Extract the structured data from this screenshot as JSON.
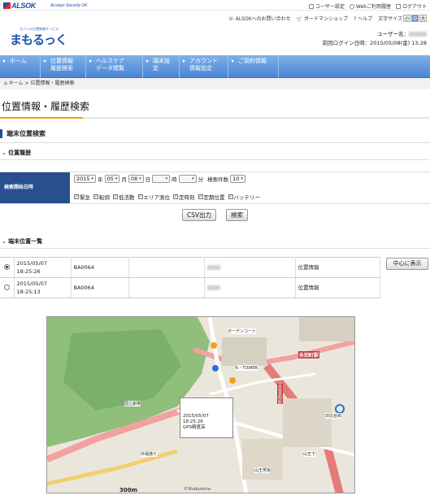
{
  "brand": {
    "name": "ALSOK",
    "tagline": "ALways Security OK",
    "logo_tagline": "モバイル位置情報サービス",
    "logo_text": "まもるっく"
  },
  "top_links": [
    "ユーザー設定",
    "Webご利用履歴",
    "ログアウト"
  ],
  "sub_links": [
    "ALSOKへのお問い合わせ",
    "ガードマンショップ",
    "ヘルプ"
  ],
  "font_size": {
    "label": "文字サイズ",
    "options": [
      "小",
      "中",
      "大"
    ],
    "selected": "中"
  },
  "user": {
    "label": "ユーザー名：",
    "last_login": "前回ログイン日時：2015/05/08(金) 13:28"
  },
  "nav": [
    {
      "line1": "ホーム",
      "line2": ""
    },
    {
      "line1": "位置情報",
      "line2": "履歴検索"
    },
    {
      "line1": "ヘルスケア",
      "line2": "データ閲覧"
    },
    {
      "line1": "端末設定",
      "line2": ""
    },
    {
      "line1": "アカウント",
      "line2": "情報設定"
    },
    {
      "line1": "ご契約情報",
      "line2": ""
    }
  ],
  "breadcrumb": {
    "home": "ホーム",
    "sep": ">",
    "current": "位置情報・履歴検索"
  },
  "page_title": "位置情報・履歴検索",
  "section_title": "端末位置検索",
  "history_subtitle": "位置履歴",
  "form": {
    "label": "検索開始日時",
    "year": "2015",
    "year_unit": "年",
    "month": "05",
    "month_unit": "月",
    "day": "08",
    "day_unit": "日",
    "hour": "",
    "hour_unit": "時",
    "minute": "",
    "minute_unit": "分",
    "count_label": "検索件数",
    "count": "10",
    "filters": [
      "緊急",
      "転倒",
      "低活動",
      "エリア測位",
      "定時刻",
      "定期位置",
      "バッテリー"
    ]
  },
  "buttons": {
    "csv": "CSV出力",
    "search": "検索",
    "center": "中心に表示"
  },
  "list_subtitle": "端末位置一覧",
  "rows": [
    {
      "date": "2015/05/07",
      "time": "18:25:26",
      "id": "BA0064",
      "type": "位置情報",
      "selected": true
    },
    {
      "date": "2015/05/07",
      "time": "18:25:13",
      "id": "BA0064",
      "type": "位置情報",
      "selected": false
    }
  ],
  "map": {
    "popup": {
      "date": "2015/05/07",
      "time": "18:25:26",
      "accuracy": "GPS精度高"
    },
    "scale": "300m",
    "copyright": "©Shobunsha",
    "labels": [
      "ガーデンコート",
      "永田町駅",
      "K・TOWER",
      "赤坂見附駅",
      "日比谷高",
      "国立劇場",
      "山王男坂",
      "外堀通り",
      "山王下"
    ]
  }
}
